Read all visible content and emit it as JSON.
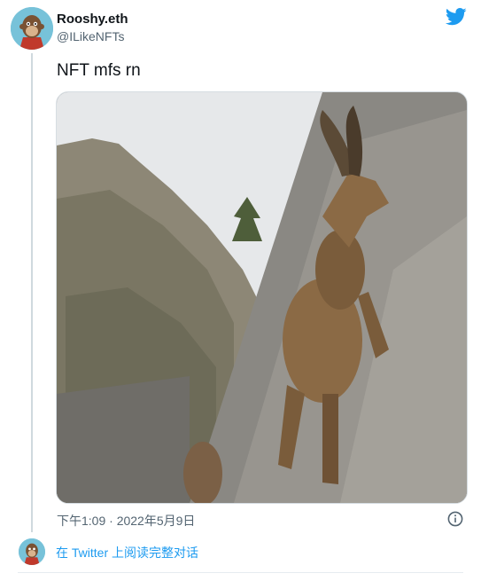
{
  "tweet": {
    "display_name": "Rooshy.eth",
    "handle": "@ILikeNFTs",
    "text": "NFT mfs rn",
    "timestamp": "下午1:09 · 2022年5月9日",
    "media_description_icon": "ibex-climbing-dam-photo"
  },
  "footer": {
    "read_conversation": "在 Twitter 上阅读完整对话"
  },
  "icons": {
    "brand": "twitter-bird-icon",
    "info": "info-icon"
  },
  "colors": {
    "accent": "#1d9bf0",
    "secondary_text": "#536471",
    "primary_text": "#0f1419"
  }
}
